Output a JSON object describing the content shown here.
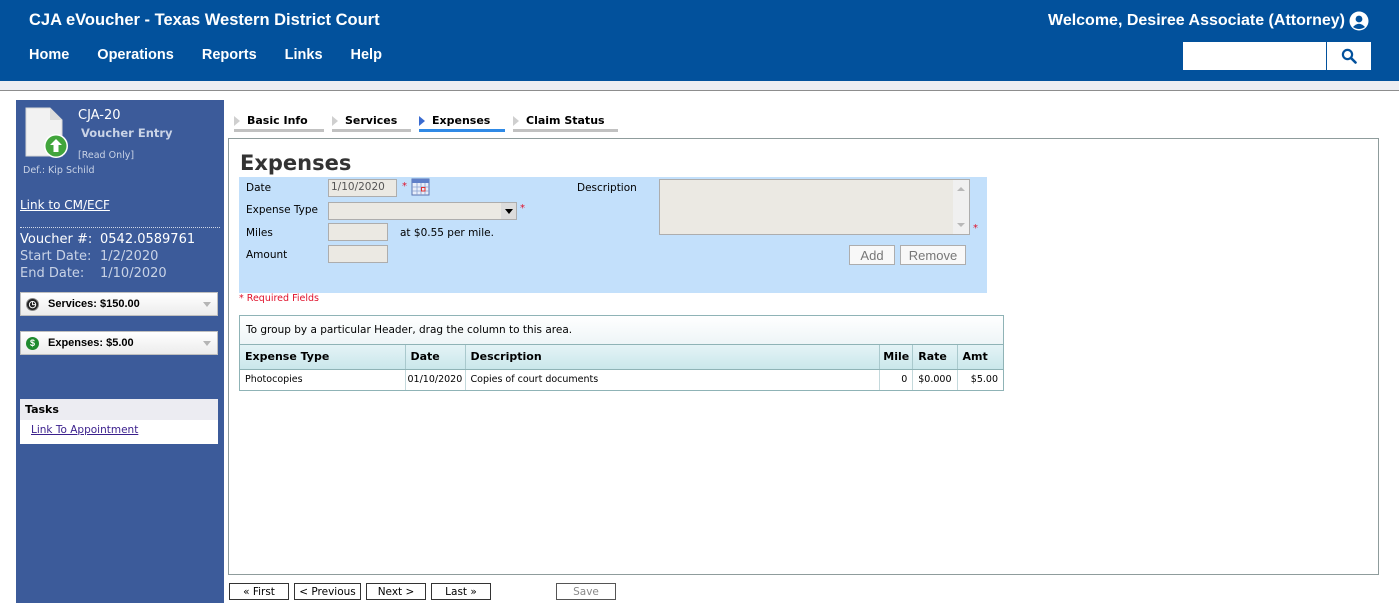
{
  "header": {
    "app_title": "CJA eVoucher - Texas Western District Court",
    "nav": [
      "Home",
      "Operations",
      "Reports",
      "Links",
      "Help"
    ],
    "welcome": "Welcome, Desiree Associate (Attorney)",
    "search_value": "",
    "icons": {
      "user": "user-circle-icon",
      "search": "search-icon"
    }
  },
  "sidebar": {
    "form_type": "CJA-20",
    "form_subtitle": "Voucher Entry",
    "mode": "[Read Only]",
    "defendant": "Def.: Kip Schild",
    "link_cmecf": "Link to CM/ECF",
    "voucher_label": "Voucher #:",
    "voucher_number": "0542.0589761",
    "start_label": "Start Date:",
    "start_date": "1/2/2020",
    "end_label": "End Date:",
    "end_date": "1/10/2020",
    "services_summary": "Services: $150.00",
    "expenses_summary": "Expenses: $5.00",
    "tasks_header": "Tasks",
    "tasks": [
      "Link To Appointment"
    ]
  },
  "tabs": [
    {
      "label": "Basic Info",
      "active": false
    },
    {
      "label": "Services",
      "active": false
    },
    {
      "label": "Expenses",
      "active": true
    },
    {
      "label": "Claim Status",
      "active": false
    }
  ],
  "main": {
    "title": "Expenses",
    "form": {
      "date_label": "Date",
      "date_value": "1/10/2020",
      "expense_type_label": "Expense Type",
      "expense_type_value": "",
      "miles_label": "Miles",
      "miles_value": "",
      "mileage_rate_note": "at $0.55 per mile.",
      "amount_label": "Amount",
      "amount_value": "",
      "description_label": "Description",
      "description_value": "",
      "required_marker": "*",
      "add_label": "Add",
      "remove_label": "Remove"
    },
    "required_note": "* Required Fields",
    "grid": {
      "group_hint": "To group by a particular Header, drag the column to this area.",
      "columns": [
        "Expense Type",
        "Date",
        "Description",
        "Mile",
        "Rate",
        "Amt"
      ],
      "rows": [
        [
          "Photocopies",
          "01/10/2020",
          "Copies of court documents",
          "0",
          "$0.000",
          "$5.00"
        ]
      ]
    }
  },
  "footer": {
    "first": "« First",
    "previous": "< Previous",
    "next": "Next >",
    "last": "Last »",
    "save": "Save"
  }
}
